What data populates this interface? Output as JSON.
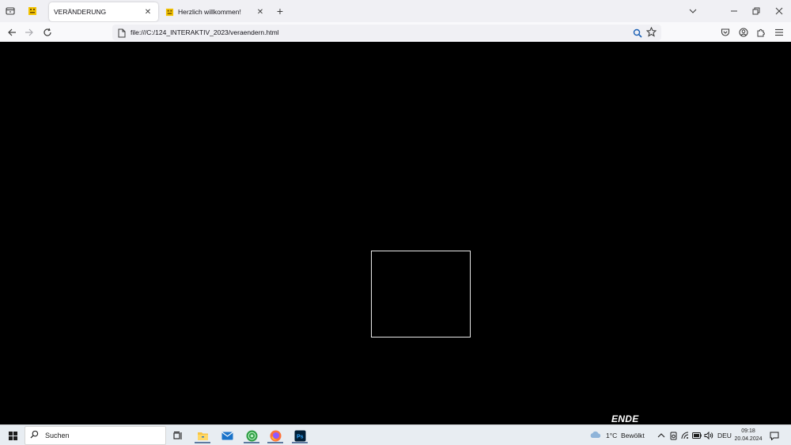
{
  "browser": {
    "tabs": [
      {
        "title": "VERÄNDERUNG",
        "active": true
      },
      {
        "title": "Herzlich willkommen!",
        "active": false
      }
    ],
    "url": "file:///C:/124_INTERAKTIV_2023/veraendern.html"
  },
  "page": {
    "ende_label": "ENDE",
    "background": "#000000",
    "square_border": "#e8e8e8"
  },
  "taskbar": {
    "search_label": "Suchen",
    "weather": "1°C  Bewölkt",
    "language": "DEU",
    "time": "09:18",
    "date": "20.04.2024"
  }
}
